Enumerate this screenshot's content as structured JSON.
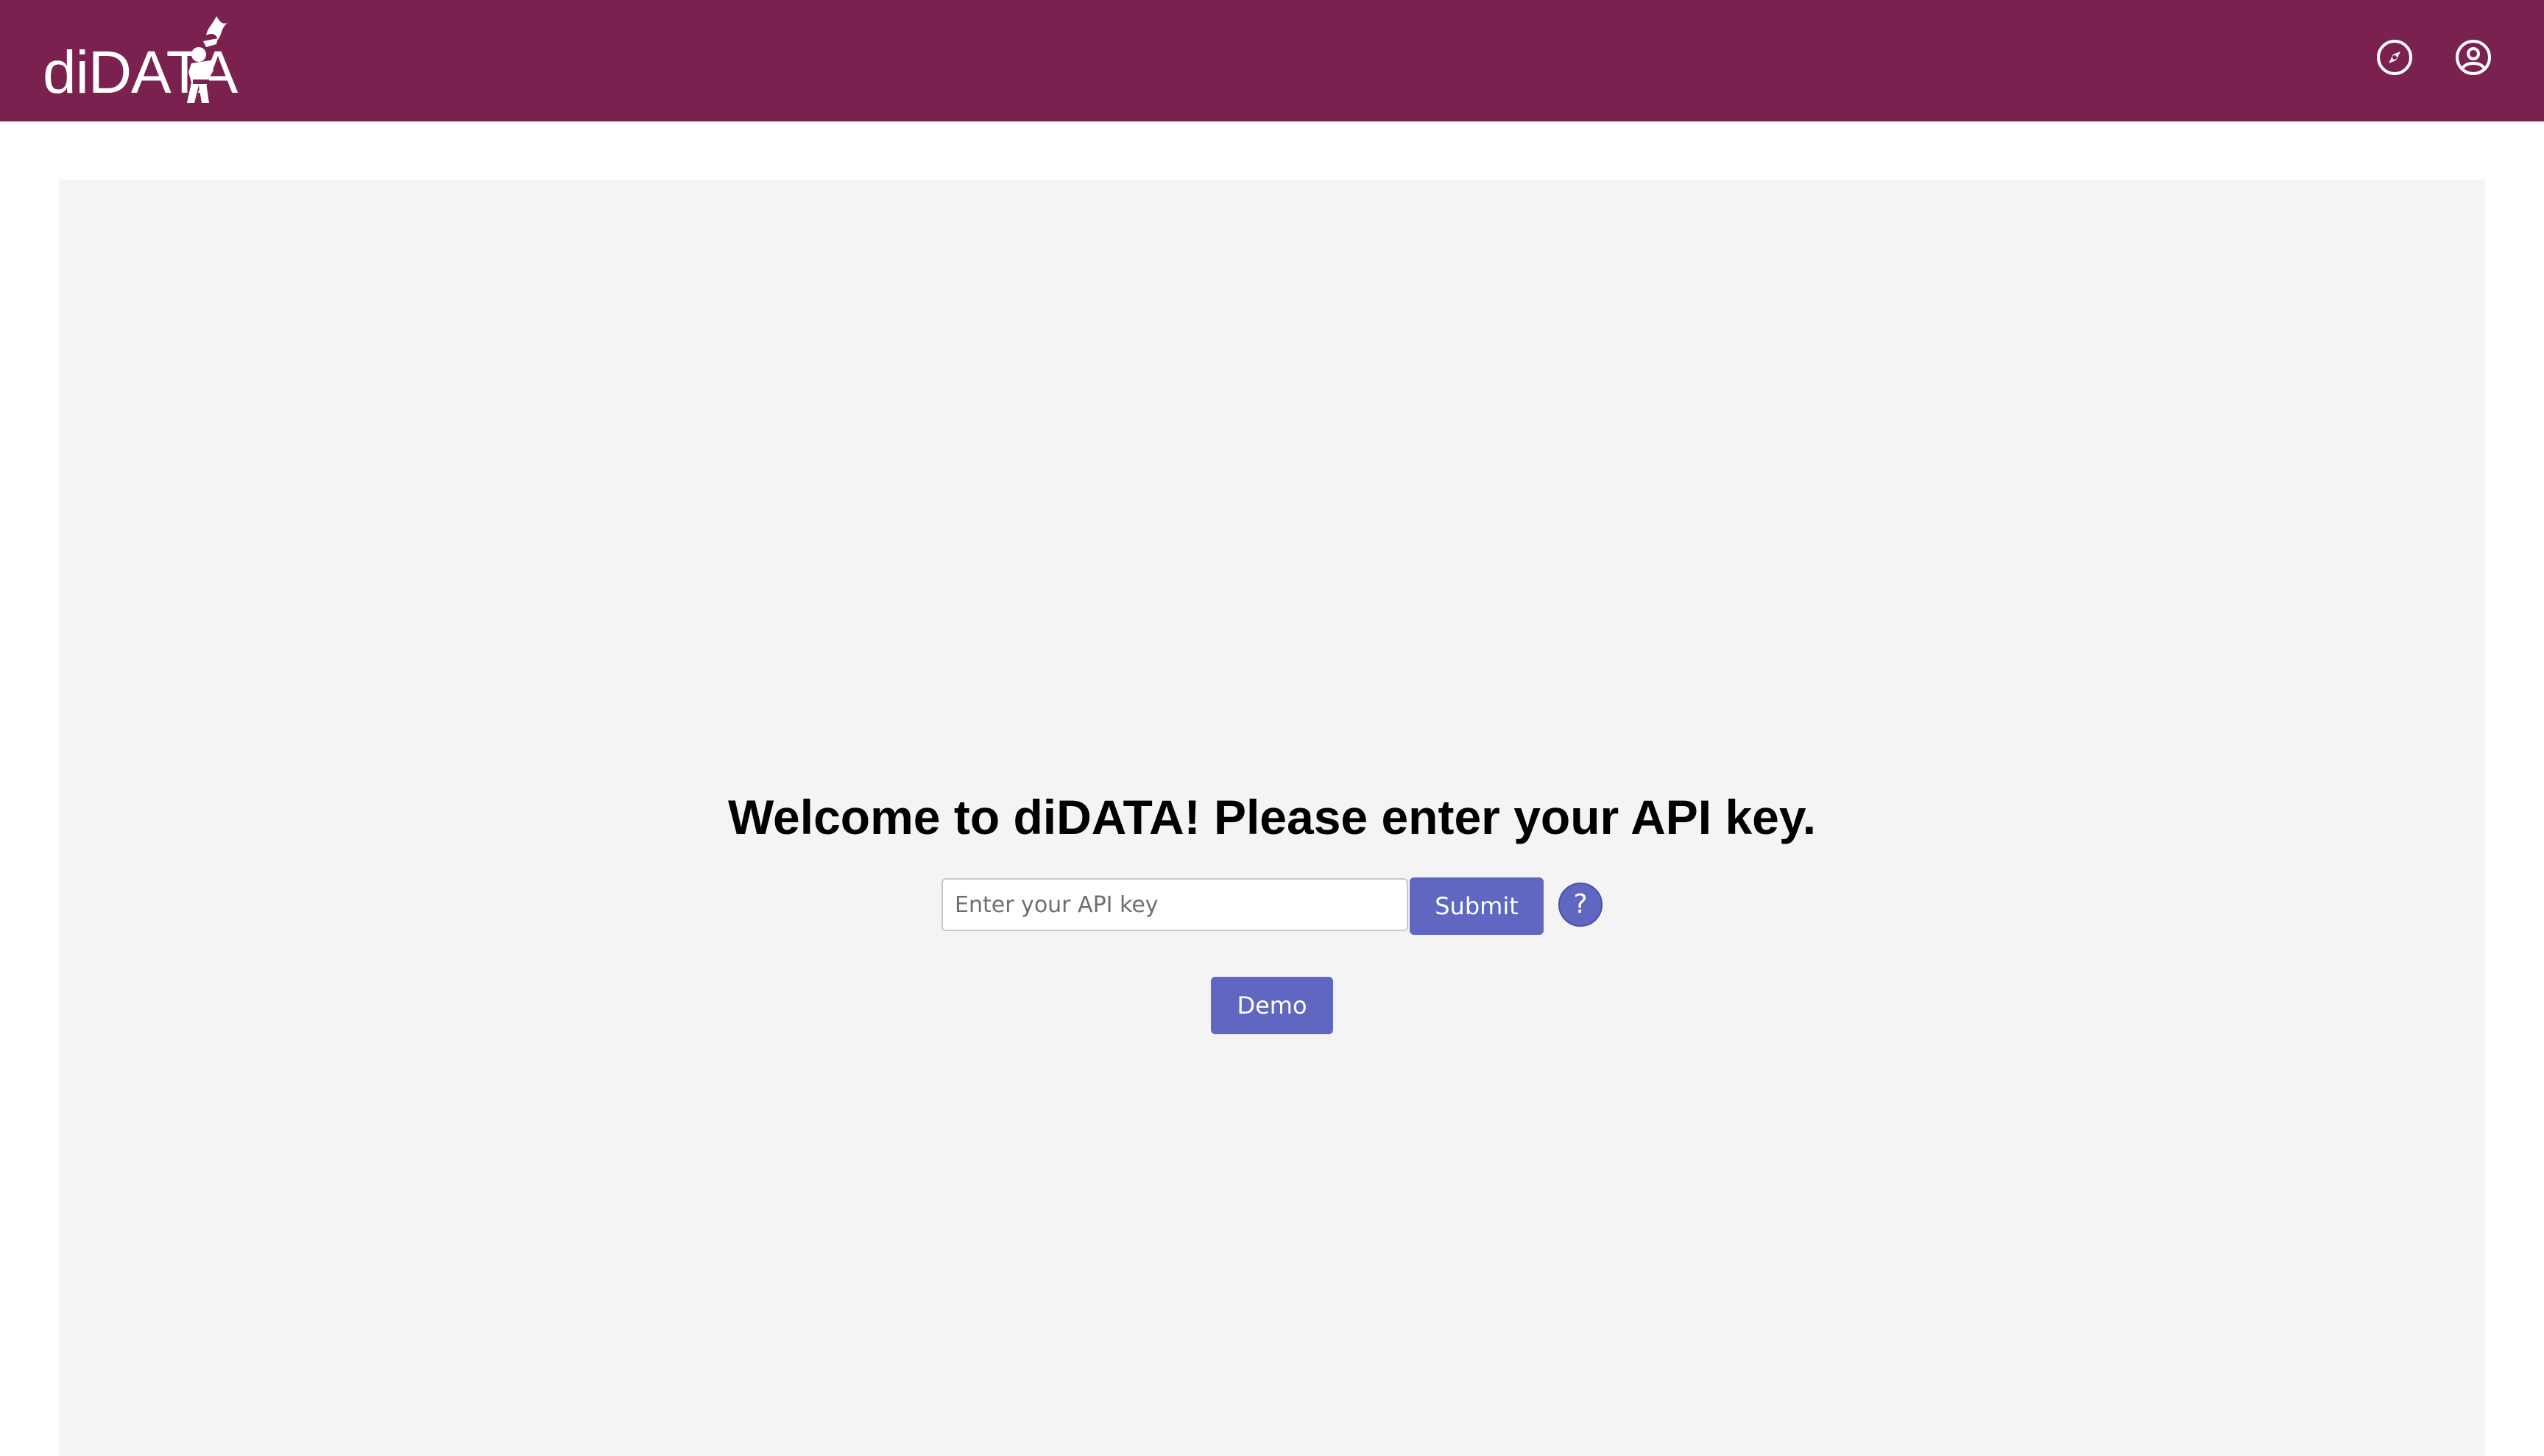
{
  "header": {
    "logo_text": "diDATA",
    "background_color": "#7b2150",
    "icons": [
      {
        "name": "compass-icon"
      },
      {
        "name": "account-icon"
      }
    ]
  },
  "main": {
    "welcome_text": "Welcome to diDATA! Please enter your API key.",
    "api_input": {
      "placeholder": "Enter your API key",
      "value": ""
    },
    "submit_label": "Submit",
    "help_label": "?",
    "demo_label": "Demo",
    "accent_color": "#5f67c2",
    "panel_color": "#f4f4f4"
  }
}
